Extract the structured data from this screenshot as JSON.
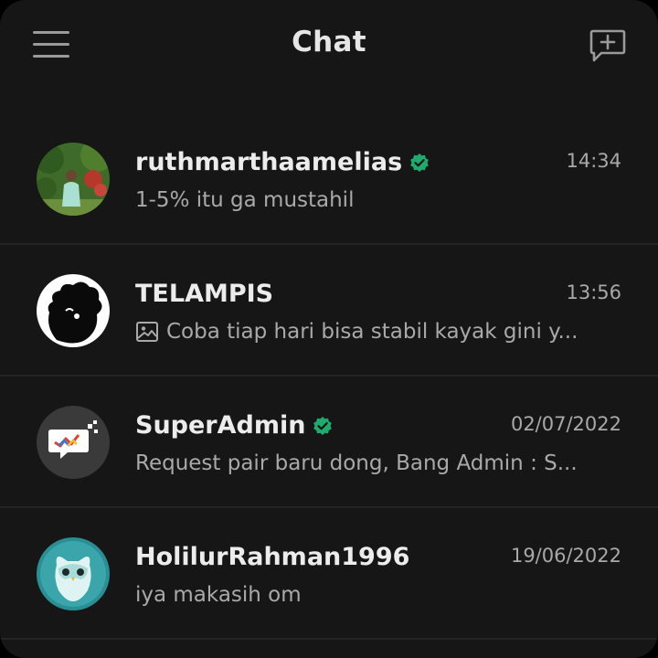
{
  "header": {
    "title": "Chat",
    "menu_icon": "hamburger-menu-icon",
    "new_chat_icon": "new-message-icon"
  },
  "colors": {
    "background": "#161616",
    "verified": "#1faa6e",
    "text_primary": "#ececec",
    "text_secondary": "#a9a9a9"
  },
  "chats": [
    {
      "name": "ruthmarthaamelias",
      "verified": true,
      "time": "14:34",
      "preview": "1-5% itu ga mustahil",
      "preview_icon": null
    },
    {
      "name": "TELAMPIS",
      "verified": false,
      "time": "13:56",
      "preview": "Coba tiap hari bisa stabil kayak gini y...",
      "preview_icon": "image-icon"
    },
    {
      "name": "SuperAdmin",
      "verified": true,
      "time": "02/07/2022",
      "preview": "Request pair baru dong, Bang Admin : S...",
      "preview_icon": null
    },
    {
      "name": "HolilurRahman1996",
      "verified": false,
      "time": "19/06/2022",
      "preview": "iya makasih om",
      "preview_icon": null
    }
  ]
}
